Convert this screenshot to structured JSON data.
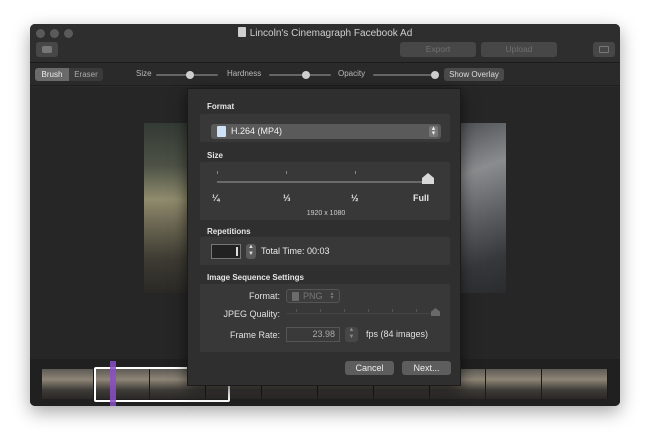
{
  "window": {
    "title": "Lincoln's Cinemagraph Facebook Ad",
    "export_label": "Export",
    "upload_label": "Upload"
  },
  "toolbar": {
    "brush_label": "Brush",
    "eraser_label": "Eraser",
    "size_label": "Size",
    "size_level": 0.55,
    "hardness_label": "Hardness",
    "hardness_level": 0.6,
    "opacity_label": "Opacity",
    "opacity_level": 1.0,
    "show_overlay_label": "Show Overlay"
  },
  "export_sheet": {
    "format_label": "Format",
    "format_value": "H.264 (MP4)",
    "size_label": "Size",
    "size_options": [
      "¼",
      "⅓",
      "½",
      "Full"
    ],
    "size_selected": "Full",
    "dimensions": "1920 x 1080",
    "repetitions_label": "Repetitions",
    "repetitions_value": "1",
    "total_time": "Total Time: 00:03",
    "image_sequence_label": "Image Sequence Settings",
    "seq_format_label": "Format:",
    "seq_format_value": "PNG",
    "jpeg_quality_label": "JPEG Quality:",
    "frame_rate_label": "Frame Rate:",
    "frame_rate_value": "23.98",
    "fps_text": "fps (84 images)",
    "cancel_label": "Cancel",
    "next_label": "Next..."
  }
}
